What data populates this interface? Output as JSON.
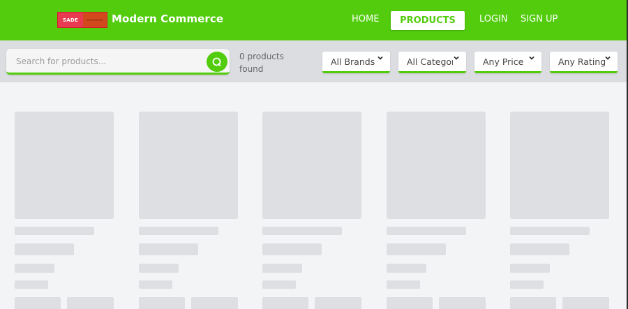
{
  "header": {
    "logo_text_main": "SADE",
    "logo_text_sub": "ecommerce",
    "brand": "Modern Commerce",
    "nav": {
      "home": "HOME",
      "products": "PRODUCTS",
      "login": "LOGIN",
      "signup": "SIGN UP"
    }
  },
  "toolbar": {
    "search_placeholder": "Search for products...",
    "results_count": "0 products found",
    "filters": {
      "brands": "All Brands",
      "categories": "All Categor",
      "price": "Any Price",
      "rating": "Any Rating"
    }
  },
  "colors": {
    "accent": "#52cc0c",
    "skeleton": "#dedfe2",
    "background": "#f3f4f6"
  },
  "icons": {
    "search": "search-icon",
    "dropdown": "chevron-down-icon"
  },
  "skeleton_cards": 5
}
